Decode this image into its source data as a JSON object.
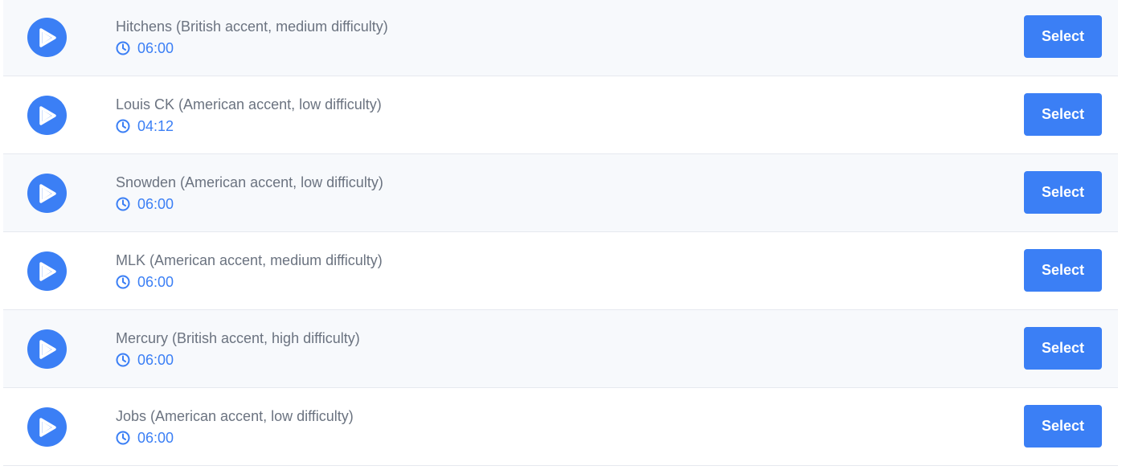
{
  "colors": {
    "accent": "#3b7ff5",
    "title_text": "#6b7380",
    "row_alt_bg": "#f7f9fc",
    "row_bg": "#ffffff",
    "divider": "#e6e9ef"
  },
  "icons": {
    "play": "play-icon",
    "clock": "clock-icon"
  },
  "tracks": [
    {
      "title": "Hitchens (British accent, medium difficulty)",
      "duration": "06:00",
      "button_label": "Select"
    },
    {
      "title": "Louis CK (American accent, low difficulty)",
      "duration": "04:12",
      "button_label": "Select"
    },
    {
      "title": "Snowden (American accent, low difficulty)",
      "duration": "06:00",
      "button_label": "Select"
    },
    {
      "title": "MLK (American accent, medium difficulty)",
      "duration": "06:00",
      "button_label": "Select"
    },
    {
      "title": "Mercury (British accent, high difficulty)",
      "duration": "06:00",
      "button_label": "Select"
    },
    {
      "title": "Jobs (American accent, low difficulty)",
      "duration": "06:00",
      "button_label": "Select"
    }
  ]
}
